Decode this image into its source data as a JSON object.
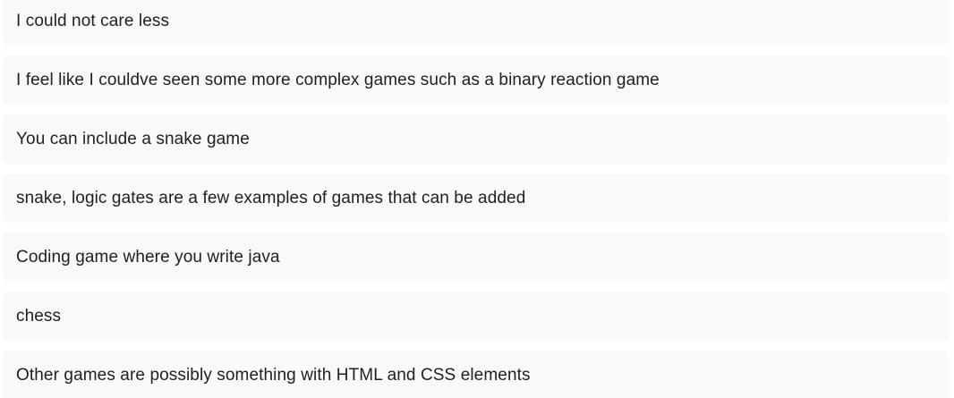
{
  "responses": [
    "I could not care less",
    "I feel like I couldve seen some more complex games such as a binary reaction game",
    "You can include a snake game",
    "snake, logic gates are a few examples of games that can be added",
    "Coding game where you write java",
    "chess",
    "Other games are possibly something with HTML and CSS elements"
  ]
}
